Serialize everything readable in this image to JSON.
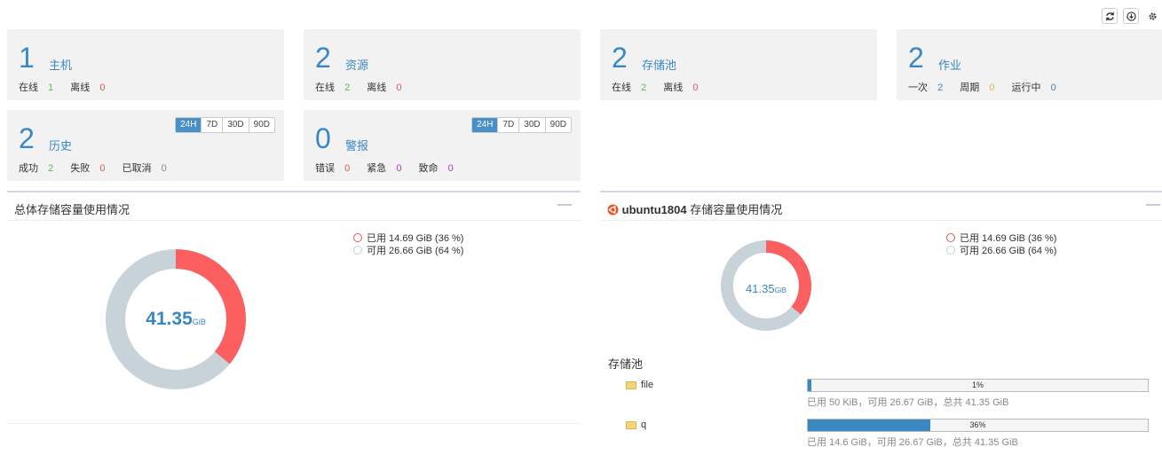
{
  "toolbar": {
    "icons": [
      "refresh-icon",
      "download-icon",
      "gear-icon"
    ]
  },
  "cards": {
    "hosts": {
      "count": "1",
      "title": "主机",
      "online_label": "在线",
      "online": "1",
      "offline_label": "离线",
      "offline": "0"
    },
    "resources": {
      "count": "2",
      "title": "资源",
      "online_label": "在线",
      "online": "2",
      "offline_label": "离线",
      "offline": "0"
    },
    "pools": {
      "count": "2",
      "title": "存储池",
      "online_label": "在线",
      "online": "2",
      "offline_label": "离线",
      "offline": "0"
    },
    "jobs": {
      "count": "2",
      "title": "作业",
      "once_label": "一次",
      "once": "2",
      "periodic_label": "周期",
      "periodic": "0",
      "running_label": "运行中",
      "running": "0"
    },
    "history": {
      "count": "2",
      "title": "历史",
      "success_label": "成功",
      "success": "2",
      "fail_label": "失败",
      "fail": "0",
      "cancel_label": "已取消",
      "cancel": "0"
    },
    "alerts": {
      "count": "0",
      "title": "警报",
      "error_label": "错误",
      "error": "0",
      "urgent_label": "紧急",
      "urgent": "0",
      "fatal_label": "致命",
      "fatal": "0"
    }
  },
  "range_options": [
    "24H",
    "7D",
    "30D",
    "90D"
  ],
  "range_selected": "24H",
  "total_panel": {
    "title": "总体存储容量使用情况",
    "center_value": "41.35",
    "center_unit": "GiB",
    "used_label": "已用 14.69 GiB (36 %)",
    "free_label": "可用 26.66 GiB (64 %)",
    "used_fraction": 0.36
  },
  "host_panel": {
    "host_name": "ubuntu1804",
    "title": "存储容量使用情况",
    "center_value": "41.35",
    "center_unit": "GiB",
    "used_label": "已用 14.69 GiB (36 %)",
    "free_label": "可用 26.66 GiB (64 %)",
    "used_fraction": 0.36,
    "pools_heading": "存储池",
    "pools": [
      {
        "name": "file",
        "pct_label": "1%",
        "fraction": 0.01,
        "note": "已用 50 KiB，可用 26.67 GiB，总共 41.35 GiB"
      },
      {
        "name": "q",
        "pct_label": "36%",
        "fraction": 0.36,
        "note": "已用 14.6 GiB，可用 26.67 GiB，总共 41.35 GiB"
      }
    ]
  },
  "colors": {
    "accent": "#3a87c2",
    "used": "#fb5f5f",
    "free": "#c8d2d9",
    "online": "#5cb85c",
    "offline": "#e55353"
  }
}
